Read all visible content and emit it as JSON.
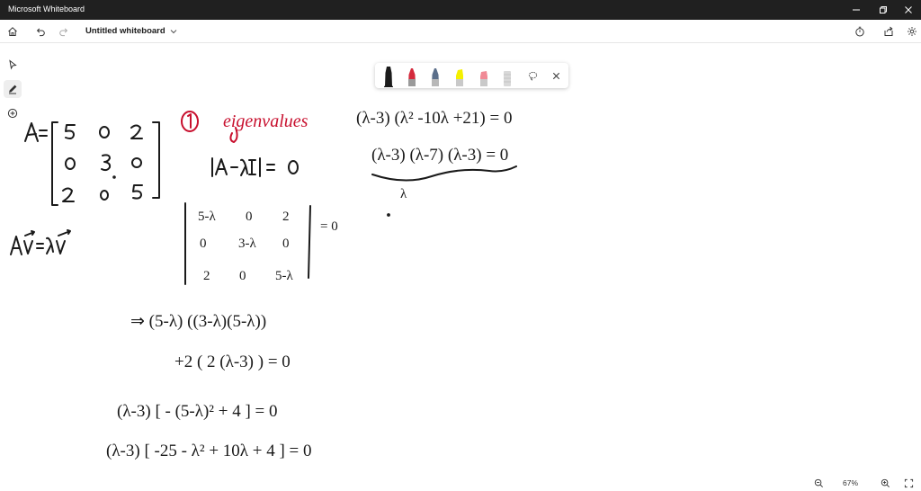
{
  "window": {
    "title": "Microsoft Whiteboard"
  },
  "header": {
    "board_title": "Untitled whiteboard"
  },
  "zoom": {
    "level": "67%"
  },
  "colors": {
    "titlebar": "#202020",
    "ink_black": "#1a1a1a",
    "ink_red": "#c8102e",
    "pen_black": "#1b1b1b",
    "pen_red": "#d42a3c",
    "pen_blue": "#5b6f8a",
    "highlighter_yellow": "#f4f000",
    "pen_pink": "#f08a96",
    "pen_gray": "#c9c9c9"
  },
  "icons": {
    "window_controls": [
      "minimize-icon",
      "maximize-icon",
      "close-icon"
    ],
    "header_left": [
      "home-icon",
      "undo-icon",
      "redo-icon",
      "chevron-down-icon"
    ],
    "header_right": [
      "timer-icon",
      "share-icon",
      "settings-icon"
    ],
    "rail": [
      "select-icon",
      "pen-icon",
      "add-icon"
    ],
    "tray": [
      "lasso-icon",
      "close-icon"
    ],
    "zoom": [
      "zoom-out-icon",
      "zoom-in-icon",
      "fit-screen-icon"
    ]
  }
}
